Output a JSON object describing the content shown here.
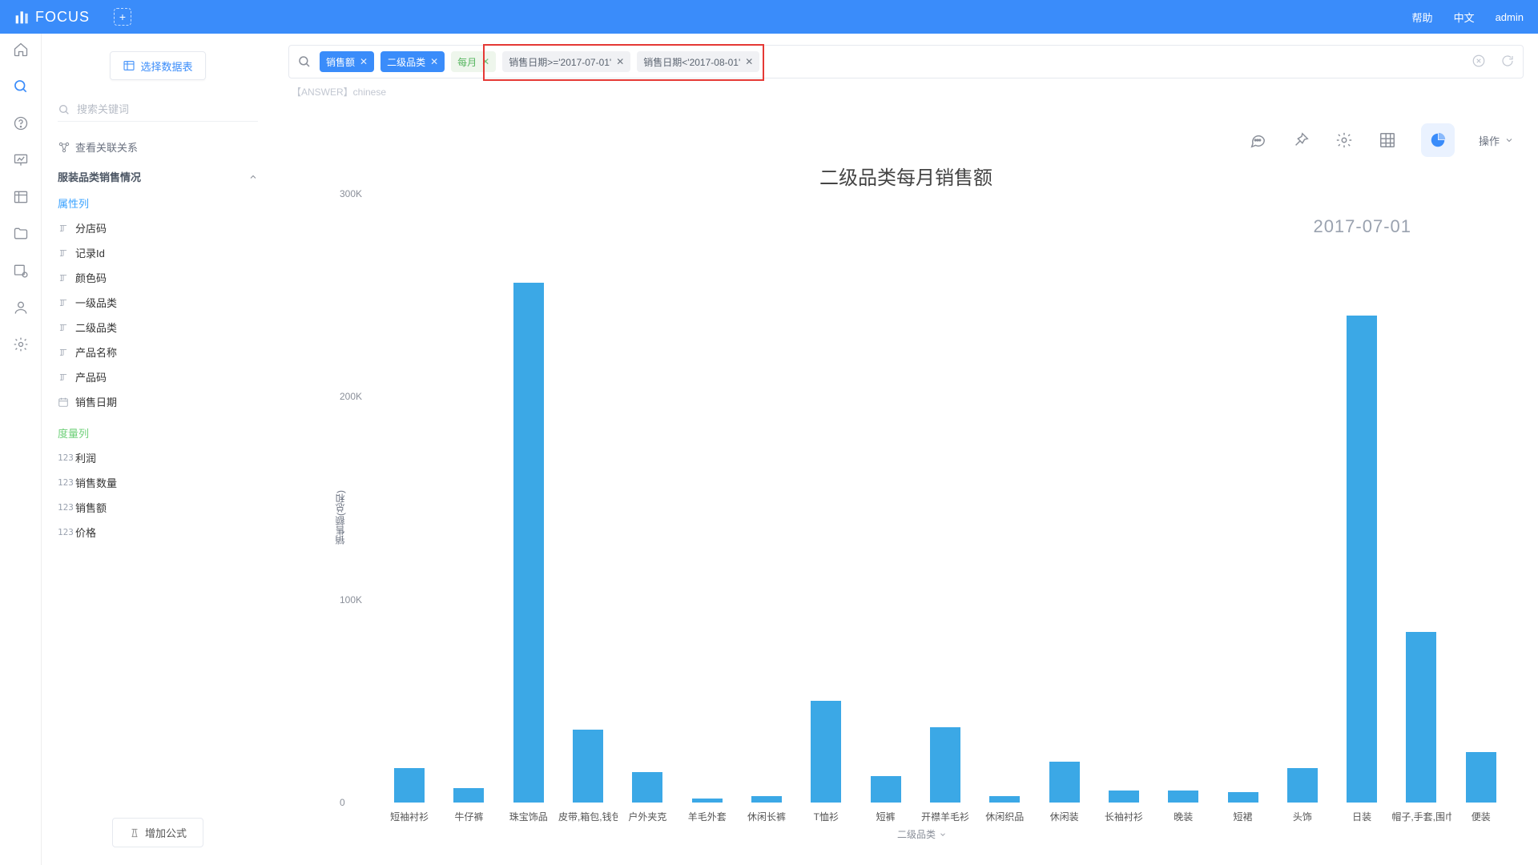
{
  "topbar": {
    "brand": "FOCUS",
    "help": "帮助",
    "lang": "中文",
    "user": "admin"
  },
  "side": {
    "select_table": "选择数据表",
    "search_placeholder": "搜索关键词",
    "view_relation": "查看关联关系",
    "group_title": "服装品类销售情况",
    "attr_label": "属性列",
    "measure_label": "度量列",
    "attrs": [
      "分店码",
      "记录Id",
      "颜色码",
      "一级品类",
      "二级品类",
      "产品名称",
      "产品码",
      "销售日期"
    ],
    "measures": [
      "利润",
      "销售数量",
      "销售额",
      "价格"
    ],
    "add_formula": "增加公式"
  },
  "search": {
    "chips_blue": [
      "销售额",
      "二级品类"
    ],
    "chip_green": "每月",
    "chips_gray": [
      "销售日期>='2017-07-01'",
      "销售日期<'2017-08-01'"
    ]
  },
  "answer_line": "【ANSWER】chinese",
  "toolbar": {
    "op_label": "操作"
  },
  "chart_data": {
    "type": "bar",
    "title": "二级品类每月销售额",
    "date_label": "2017-07-01",
    "ylabel": "销售额(总和)",
    "xlabel": "二级品类",
    "ylim": [
      0,
      300000
    ],
    "ticks": [
      0,
      100000,
      200000,
      300000
    ],
    "tick_labels": [
      "0",
      "100K",
      "200K",
      "300K"
    ],
    "categories": [
      "短袖衬衫",
      "牛仔裤",
      "珠宝饰品",
      "皮带,箱包,钱包",
      "户外夹克",
      "羊毛外套",
      "休闲长裤",
      "T恤衫",
      "短裤",
      "开襟羊毛衫",
      "休闲织品",
      "休闲装",
      "长袖衬衫",
      "晚装",
      "短裙",
      "头饰",
      "日装",
      "帽子,手套,围巾",
      "便装"
    ],
    "values": [
      17000,
      7000,
      256000,
      36000,
      15000,
      2000,
      3000,
      50000,
      13000,
      37000,
      3000,
      20000,
      6000,
      6000,
      5000,
      17000,
      240000,
      84000,
      25000
    ]
  }
}
